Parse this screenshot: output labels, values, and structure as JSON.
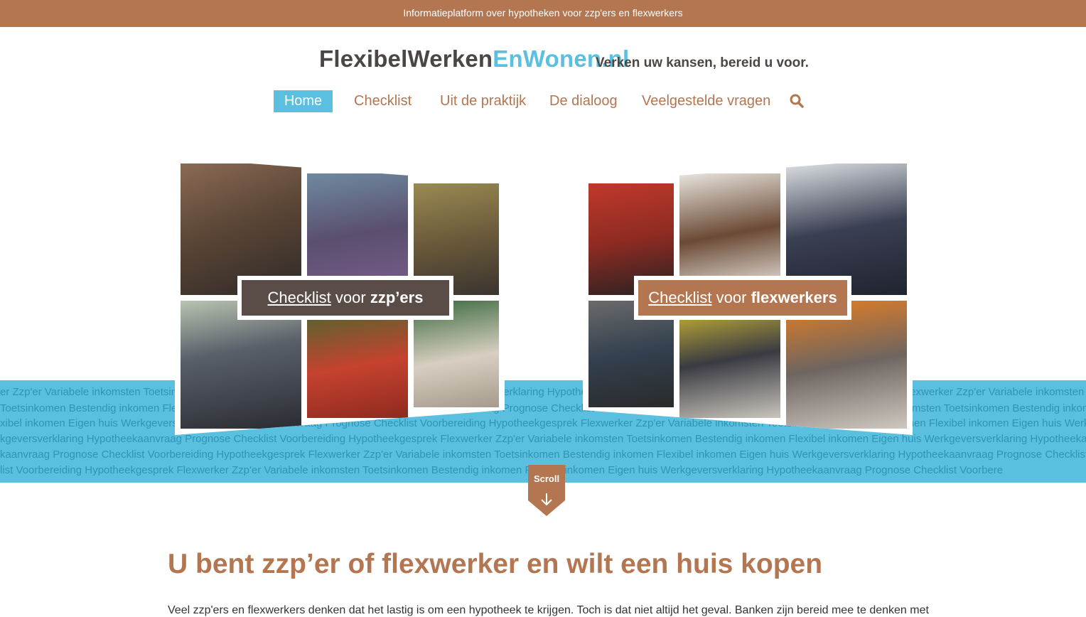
{
  "topbar": {
    "text": "Informatieplatform over hypotheken voor zzp'ers en flexwerkers"
  },
  "header": {
    "logo_main": "FlexibelWerken",
    "logo_accent": "EnWonen.nl",
    "tagline": "Verken uw kansen, bereid u voor."
  },
  "nav": {
    "items": [
      {
        "label": "Home",
        "active": true
      },
      {
        "label": "Checklist"
      },
      {
        "label": "Uit de praktijk"
      },
      {
        "label": "De dialoog"
      },
      {
        "label": "Veelgestelde vragen"
      }
    ],
    "search_icon": "search-icon"
  },
  "tag_band": {
    "rows": [
      "er   Zzp'er   Variabele inkomsten   Toetsinkomen   Bestendig inkomen   Flexibel inkomen   Eigen huis   Werkgeversverklaring   Hypotheekaanvraag   Prognose   Checklist   Voorbereiding   Hypotheekgesprek Flexwerker   Zzp'er   Variabele inkomsten   Toetsinkomen   Bestendig inkomen   Flexibel inkomen   Eigen huis   Werkgeversverklaring   Hypotheekgesprek Flexwerker   Zzp'er   V",
      "Toetsinkomen   Bestendig inkomen   Flexibel inkomen   Eigen huis   Werkgeversverklaring   Hypotheekaanvraag   Prognose   Checklist   Voorbereiding   Hypotheekgesprek Flexwerker   Zzp'er   Variabele inkomsten   Toetsinkomen   Bestendig inkomen   Flexibel inkomen   Eigen huis   Werkgeversverklaring   Hypotheekaanvraag   Prognose   Checklist   Variabele inkomsten   Toetsinkomen",
      "xibel inkomen   Eigen huis   Werkgeversverklaring   Hypotheekaanvraag   Prognose   Checklist   Voorbereiding   Hypotheekgesprek Flexwerker   Zzp'er   Variabele inkomsten   Toetsinkomen   Bestendig inkomen   Flexibel inkomen   Eigen huis   Werkgeversverklaring   Hypotheekaanvraag   Prognose   Checklist   Voorbereiding   Bestendig inkomen   Flexibel inkome",
      "kgeversverklaring   Hypotheekaanvraag   Prognose   Checklist   Voorbereiding   Hypotheekgesprek Flexwerker   Zzp'er   Variabele inkomsten   Toetsinkomen   Bestendig inkomen   Flexibel inkomen   Eigen huis   Werkgeversverklaring   Hypotheekaanvraag   Prognose   Checklist   Voorbereiding   Hypotheekgesprek Flexwerker   Eigen huis   Werkgeversverkla",
      "kaanvraag   Prognose   Checklist   Voorbereiding   Hypotheekgesprek Flexwerker   Zzp'er   Variabele inkomsten   Toetsinkomen   Bestendig inkomen   Flexibel inkomen   Eigen huis   Werkgeversverklaring   Hypotheekaanvraag   Prognose   Checklist   Voorbereiding   Hypotheekgesprek Flexwerker   Zzp'er   Variabele inkomsten   Toetsinkomen   Hypotheekaanvraag   P",
      "list   Voorbereiding   Hypotheekgesprek Flexwerker   Zzp'er   Variabele inkomsten   Toetsinkomen   Bestendig inkomen   Flexibel inkomen   Eigen huis   Werkgeversverklaring   Hypotheekaanvraag   Prognose   Checklist   Voorbere"
    ]
  },
  "cta_left": {
    "link": "Checklist",
    "middle": "voor",
    "bold": "zzp’ers"
  },
  "cta_right": {
    "link": "Checklist",
    "middle": "voor",
    "bold": "flexwerkers"
  },
  "scroll": {
    "label": "Scroll",
    "icon": "arrow-down-icon"
  },
  "main": {
    "heading": "U bent zzp’er of flexwerker en wilt een huis kopen",
    "paragraph": "Veel zzp'ers en flexwerkers denken dat het lastig is om een hypotheek te krijgen. Toch is dat niet altijd het geval. Banken zijn bereid mee te denken met"
  },
  "colors": {
    "brown": "#b37650",
    "blue": "#5bbfdf",
    "dark": "#4b4643",
    "cta_dark": "#5a4d48"
  }
}
